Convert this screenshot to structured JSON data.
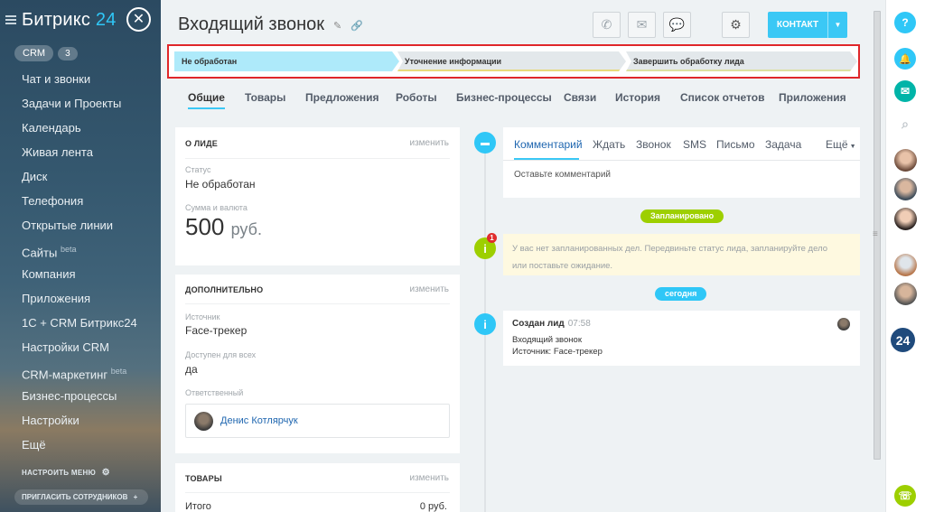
{
  "sidebar": {
    "logo_main": "Битрикс",
    "logo_num": "24",
    "close_glyph": "✕",
    "crm_label": "CRM",
    "crm_count": "3",
    "items": [
      {
        "label": "Чат и звонки",
        "sup": ""
      },
      {
        "label": "Задачи и Проекты",
        "sup": ""
      },
      {
        "label": "Календарь",
        "sup": ""
      },
      {
        "label": "Живая лента",
        "sup": ""
      },
      {
        "label": "Диск",
        "sup": ""
      },
      {
        "label": "Телефония",
        "sup": ""
      },
      {
        "label": "Открытые линии",
        "sup": ""
      },
      {
        "label": "Сайты",
        "sup": "beta"
      },
      {
        "label": "Компания",
        "sup": ""
      },
      {
        "label": "Приложения",
        "sup": ""
      },
      {
        "label": "1С + CRM Битрикс24",
        "sup": ""
      },
      {
        "label": "Настройки CRM",
        "sup": ""
      },
      {
        "label": "CRM-маркетинг",
        "sup": "beta"
      },
      {
        "label": "Бизнес-процессы",
        "sup": ""
      },
      {
        "label": "Настройки",
        "sup": ""
      },
      {
        "label": "Ещё",
        "sup": ""
      }
    ],
    "configure_menu": "НАСТРОИТЬ МЕНЮ",
    "invite": "ПРИГЛАСИТЬ СОТРУДНИКОВ"
  },
  "header": {
    "title": "Входящий звонок",
    "contact_button": "КОНТАКТ"
  },
  "stages": [
    {
      "label": "Не обработан"
    },
    {
      "label": "Уточнение информации"
    },
    {
      "label": "Завершить обработку лида"
    }
  ],
  "tabs": [
    {
      "label": "Общие"
    },
    {
      "label": "Товары"
    },
    {
      "label": "Предложения"
    },
    {
      "label": "Роботы"
    },
    {
      "label": "Бизнес-процессы"
    },
    {
      "label": "Связи"
    },
    {
      "label": "История"
    },
    {
      "label": "Список отчетов"
    },
    {
      "label": "Приложения"
    }
  ],
  "about": {
    "title": "О ЛИДЕ",
    "edit": "изменить",
    "status_label": "Статус",
    "status_value": "Не обработан",
    "sum_label": "Сумма и валюта",
    "sum_value": "500",
    "currency": "руб."
  },
  "extra": {
    "title": "ДОПОЛНИТЕЛЬНО",
    "edit": "изменить",
    "source_label": "Источник",
    "source_value": "Face-трекер",
    "access_label": "Доступен для всех",
    "access_value": "да",
    "responsible_label": "Ответственный",
    "responsible_name": "Денис Котлярчук"
  },
  "products": {
    "title": "ТОВАРЫ",
    "edit": "изменить",
    "total_label": "Итого",
    "total_value": "0 руб."
  },
  "timeline": {
    "tabs": [
      "Комментарий",
      "Ждать",
      "Звонок",
      "SMS",
      "Письмо",
      "Задача",
      "Ещё"
    ],
    "placeholder": "Оставьте комментарий",
    "planned_badge": "Запланировано",
    "warn_text": "У вас нет запланированных дел. Передвиньте статус лида, запланируйте дело или поставьте ожидание.",
    "warn_count": "1",
    "today_badge": "сегодня",
    "event_title": "Создан лид",
    "event_time": "07:58",
    "event_line1": "Входящий звонок",
    "event_line2": "Источник: Face-трекер"
  },
  "colors": {
    "accent": "#3bc8f5",
    "planned": "#9dcf00",
    "stage_active": "#aeeafa"
  },
  "icons": {
    "help": "?",
    "bell": "🔔",
    "phone": "☏"
  }
}
